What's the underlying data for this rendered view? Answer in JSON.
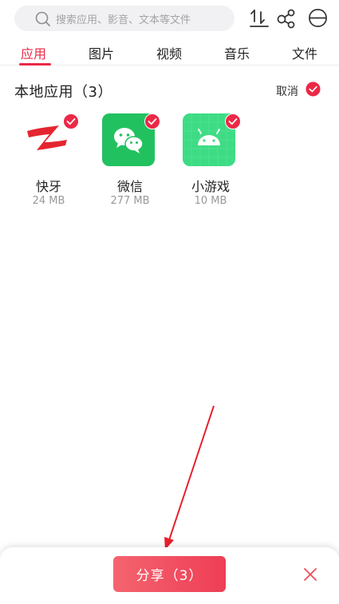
{
  "search": {
    "placeholder": "搜索应用、影音、文本等文件",
    "icon": "search-icon"
  },
  "toolbar": {
    "icons": [
      "download-icon",
      "share-nodes-icon",
      "menu-icon"
    ]
  },
  "tabs": [
    {
      "label": "应用",
      "active": true
    },
    {
      "label": "图片",
      "active": false
    },
    {
      "label": "视频",
      "active": false
    },
    {
      "label": "音乐",
      "active": false
    },
    {
      "label": "文件",
      "active": false
    }
  ],
  "section": {
    "title": "本地应用（3）",
    "cancel_label": "取消"
  },
  "apps": [
    {
      "name": "快牙",
      "size": "24 MB",
      "selected": true,
      "icon": "kuaiya-logo-icon"
    },
    {
      "name": "微信",
      "size": "277 MB",
      "selected": true,
      "icon": "wechat-icon"
    },
    {
      "name": "小游戏",
      "size": "10 MB",
      "selected": true,
      "icon": "android-icon"
    }
  ],
  "bottom": {
    "share_label": "分享（3）",
    "close_icon": "close-icon"
  },
  "colors": {
    "accent": "#ec2846",
    "wechat": "#22c160",
    "android": "#3ddc84"
  }
}
